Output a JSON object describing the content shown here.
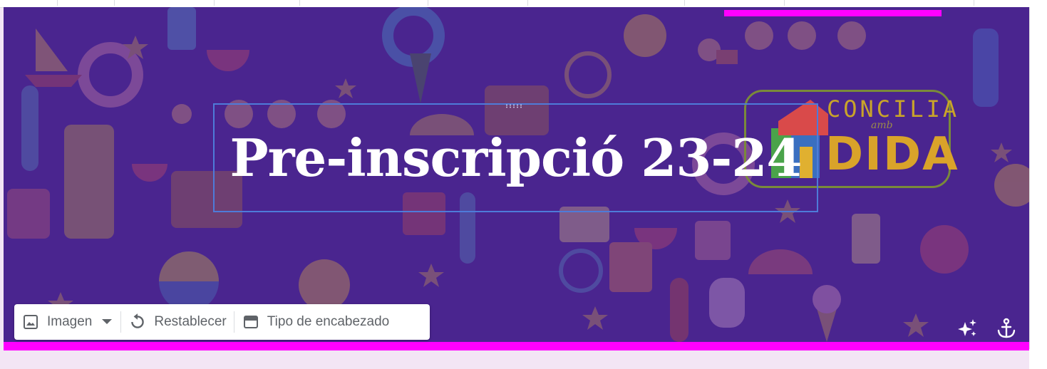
{
  "banner": {
    "title": "Pre-inscripció 23-24",
    "logo_line1": "CONCILIA",
    "logo_amb": "amb",
    "logo_line2": "DIDA"
  },
  "toolbar": {
    "image_label": "Imagen",
    "reset_label": "Restablecer",
    "header_type_label": "Tipo de encabezado"
  },
  "icons": {
    "image": "image-icon",
    "dropdown": "caret-down-icon",
    "reset": "reset-icon",
    "header_type": "header-type-icon",
    "sparkle": "sparkle-icon",
    "anchor": "anchor-icon"
  },
  "colors": {
    "banner_overlay": "#4a2590",
    "accent_magenta": "#ff00ff",
    "page_background": "#f3e5f5",
    "title_text": "#ffffff",
    "selection_border": "#4e7bd9"
  }
}
